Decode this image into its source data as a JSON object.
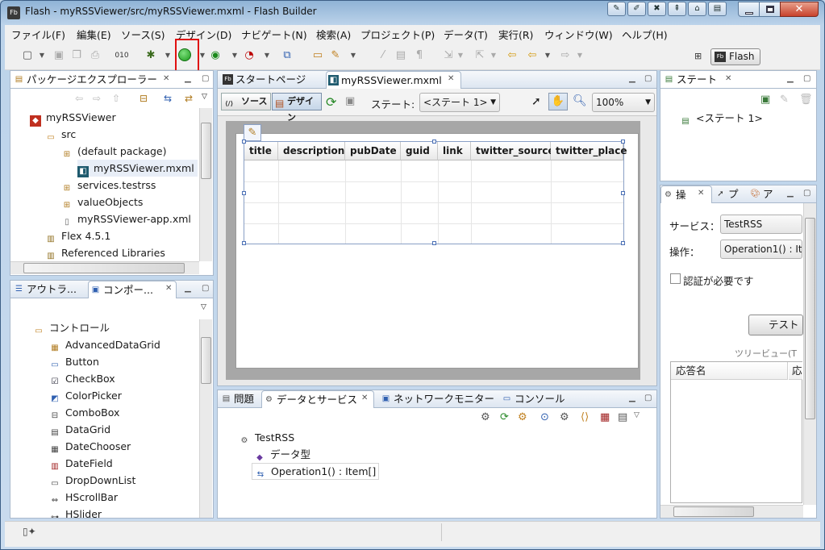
{
  "window": {
    "title": "Flash - myRSSViewer/src/myRSSViewer.mxml - Flash Builder",
    "app_icon": "Fb",
    "close_glyph": "✕"
  },
  "menubar": [
    "ファイル(F)",
    "編集(E)",
    "ソース(S)",
    "デザイン(D)",
    "ナビゲート(N)",
    "検索(A)",
    "プロジェクト(P)",
    "データ(T)",
    "実行(R)",
    "ウィンドウ(W)",
    "ヘルプ(H)"
  ],
  "perspective": {
    "label": "Flash",
    "icon": "Fb"
  },
  "package_explorer": {
    "tab": "パッケージエクスプローラー",
    "tree": [
      {
        "label": "myRSSViewer",
        "icon": "project-icon"
      },
      {
        "label": "src",
        "icon": "folder-icon"
      },
      {
        "label": "(default package)",
        "icon": "package-icon"
      },
      {
        "label": "myRSSViewer.mxml",
        "icon": "mxml-file-icon"
      },
      {
        "label": "services.testrss",
        "icon": "package-icon"
      },
      {
        "label": "valueObjects",
        "icon": "package-icon"
      },
      {
        "label": "myRSSViewer-app.xml",
        "icon": "xml-file-icon"
      },
      {
        "label": "Flex 4.5.1",
        "icon": "library-icon"
      },
      {
        "label": "Referenced Libraries",
        "icon": "library-icon"
      }
    ]
  },
  "outline_panel": {
    "tab1": "アウトラ...",
    "tab2": "コンポー..."
  },
  "components": {
    "folder": "コントロール",
    "items": [
      "AdvancedDataGrid",
      "Button",
      "CheckBox",
      "ColorPicker",
      "ComboBox",
      "DataGrid",
      "DateChooser",
      "DateField",
      "DropDownList",
      "HScrollBar",
      "HSlider"
    ]
  },
  "editor": {
    "tabs": [
      "スタートページ",
      "myRSSViewer.mxml"
    ],
    "source_btn": "ソース",
    "design_btn": "デザイン",
    "state_label": "ステート:",
    "state_value": "<ステート 1>",
    "zoom": "100%",
    "grid_columns": [
      "title",
      "description",
      "pubDate",
      "guid",
      "link",
      "twitter_source",
      "twitter_place"
    ]
  },
  "states_panel": {
    "tab": "ステート",
    "item": "<ステート 1>"
  },
  "ops_panel": {
    "tab1": "操",
    "tab2": "プ",
    "tab3": "ア",
    "service_label": "サービス：",
    "service_value": "TestRSS",
    "operation_label": "操作：",
    "operation_value": "Operation1() : It",
    "auth_label": "認証が必要です",
    "test_button": "テスト",
    "treeview_label": "ツリービュー(T",
    "col1": "応答名",
    "col2": "応"
  },
  "bottom_panel": {
    "tabs": [
      "問題",
      "データとサービス",
      "ネットワークモニター",
      "コンソール"
    ],
    "tree": [
      {
        "label": "TestRSS",
        "icon": "service-icon"
      },
      {
        "label": "データ型",
        "icon": "data-type-icon"
      },
      {
        "label": "Operation1() : Item[]",
        "icon": "operation-icon"
      }
    ]
  }
}
